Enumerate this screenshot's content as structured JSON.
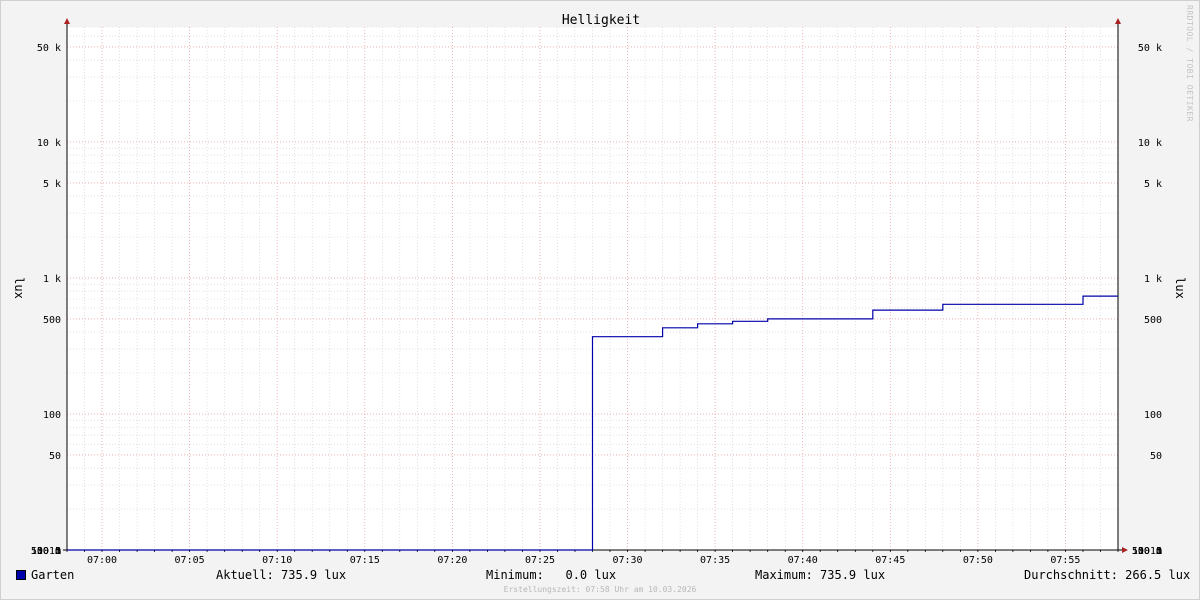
{
  "chart_data": {
    "type": "line",
    "title": "Helligkeit",
    "ylabel": "lux",
    "yscale": "log",
    "ylim": [
      10,
      70000
    ],
    "xlim": [
      "06:58:00",
      "07:58:00"
    ],
    "y_ticks": [
      {
        "value": 10,
        "label": "10 m"
      },
      {
        "value": 50,
        "label": "50 m"
      },
      {
        "value": 100,
        "label": "100 m"
      },
      {
        "value": 500,
        "label": "500 m"
      },
      {
        "value": 1000,
        "label": "1"
      },
      {
        "value": 5000,
        "label": "5"
      },
      {
        "value": 10000,
        "label": "10"
      },
      {
        "value": 50000,
        "label": "50"
      },
      {
        "value": 100000,
        "label": "100"
      },
      {
        "value": 500000,
        "label": "500"
      },
      {
        "value": 1000000,
        "label": "1 k"
      },
      {
        "value": 5000000,
        "label": "5 k"
      },
      {
        "value": 10000000,
        "label": "10 k"
      },
      {
        "value": 50000000,
        "label": "50 k"
      }
    ],
    "x_ticks": [
      "07:00",
      "07:05",
      "07:10",
      "07:15",
      "07:20",
      "07:25",
      "07:30",
      "07:35",
      "07:40",
      "07:45",
      "07:50",
      "07:55"
    ],
    "grid": true,
    "series": [
      {
        "name": "Garten",
        "color": "#0000aa",
        "step": true,
        "x": [
          "06:58:00",
          "07:28:00",
          "07:32:00",
          "07:34:00",
          "07:36:00",
          "07:38:00",
          "07:44:00",
          "07:48:00",
          "07:56:00",
          "07:58:00"
        ],
        "values": [
          0,
          370,
          430,
          460,
          480,
          500,
          580,
          640,
          735.9,
          735.9
        ]
      }
    ]
  },
  "legend": {
    "series_name": "Garten",
    "current": "Aktuell: 735.9 lux",
    "minimum": "Minimum:   0.0 lux",
    "maximum": "Maximum: 735.9 lux",
    "average": "Durchschnitt: 266.5 lux"
  },
  "footer": "Erstellungszeit: 07:58 Uhr am 10.03.2026",
  "watermark": "RRDTOOL / TOBI OETIKER",
  "colors": {
    "line": "#0000aa",
    "major_grid": "#f0a0a0",
    "minor_grid": "#cfcfcf",
    "axis": "#000000",
    "arrow": "#aa2222",
    "plot_bg": "#ffffff",
    "canvas_bg": "#f3f3f3"
  }
}
